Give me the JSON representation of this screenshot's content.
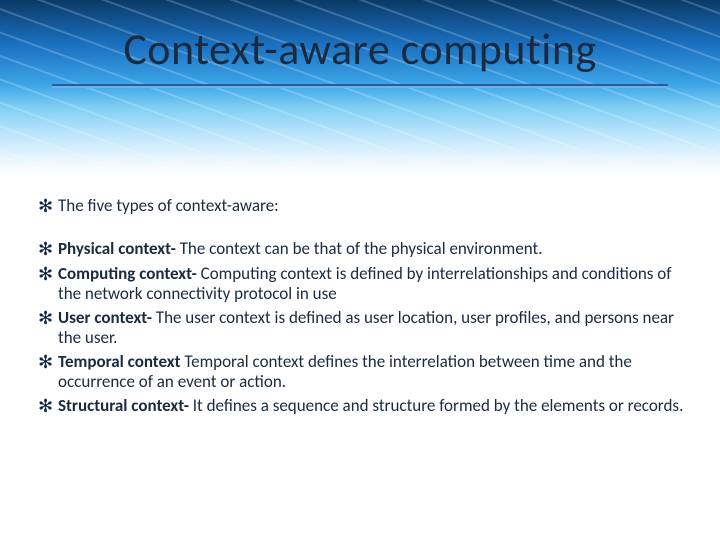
{
  "title": "Context-aware computing",
  "intro": "The five types of context-aware:",
  "items": [
    {
      "label": "Physical context- ",
      "desc": "The context can be that of the physical environment."
    },
    {
      "label": "Computing context- ",
      "desc": "Computing context is defined by interrelationships and conditions of the network connectivity protocol in use"
    },
    {
      "label": "User context- ",
      "desc": "The user context is defined as user location, user profiles, and persons near the user."
    },
    {
      "label": "Temporal context ",
      "desc": "Temporal context defines the interrelation between time and the occurrence of an event or action."
    },
    {
      "label": "Structural context- ",
      "desc": "It defines a sequence and structure formed by the elements or records."
    }
  ],
  "bullet_glyph": "✻"
}
